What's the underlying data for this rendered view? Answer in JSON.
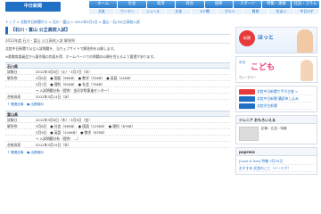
{
  "header": {
    "logo": "中日新聞",
    "nav_primary": [
      "ホーム",
      "社会",
      "経済",
      "政治",
      "国際",
      "スポーツ",
      "特集・連載",
      "社説・コラム"
    ],
    "nav_secondary": [
      "天気",
      "ウーマン",
      "ニュース",
      "文化",
      "ラテ欄",
      "グルメ",
      "教育",
      "住まい",
      "中日スポ"
    ],
    "breadcrumb": "トップ > 北陸中日新聞から > 石川・富山 > 2012年3月2日 > 富山・石川公立高校入試"
  },
  "article": {
    "title": "【石川・富山 公立高校入試】",
    "subtitle": "2012年度 石川・富山 公立高校入試 解答例",
    "note": "北陸中日新聞で公立入試問題を、当ウェブサイトで解答例を公開します。",
    "note2": "※県教育委員会から著作権の許諾を得、ホームページでの問題の公開を控えるよう要望があります。",
    "regions": [
      {
        "name": "石川県",
        "rows": [
          {
            "label": "試験日",
            "value": "2012年3月6日（火）・3月7日（水）"
          },
          {
            "label": "解答例",
            "value": "3月6日　● 国語（96KB）　● 数学（52KB）　● 英語（42KB）"
          },
          {
            "label": "",
            "value": "3月7日　● 理科（92KB）　● 社会（75KB）"
          },
          {
            "label": "",
            "value": "→ 入試問題分析（提供：金沢学院東進センター）"
          },
          {
            "label": "合格発表",
            "value": "2012年3月14日（水）"
          }
        ]
      },
      {
        "name": "富山県",
        "rows": [
          {
            "label": "試験日",
            "value": "2012年3月8日（木）・3月9日（金）"
          },
          {
            "label": "解答例",
            "value": "3月8日　● 社会（96KB）　● 国語（125KB）　● 理科（67KB）"
          },
          {
            "label": "",
            "value": "3月9日　● 英語（144KB）　● 数学（67KB）"
          },
          {
            "label": "",
            "value": "→ 入試問題分析（提供：…）"
          },
          {
            "label": "合格発表",
            "value": "2012年3月15日（木）"
          }
        ]
      }
    ],
    "back_link": "↑ 関連記事　● 出題傾向"
  },
  "sidebar": {
    "ad1": {
      "text": "ほっと",
      "badge": "新聞",
      "sub": "web"
    },
    "ad2": {
      "small": "中日",
      "big": "こども",
      "sub": "ウィークリー"
    },
    "links": [
      "北陸中日新聞で手引き書 >",
      "北陸中日新聞 購読申し込み",
      "北陸学生新聞"
    ],
    "section1": "ジュニア おもろいえる",
    "section1_caption": "記事・広告・特集",
    "section2": "popress",
    "section2_items": [
      "[Love & Sex] 特集 3月20日",
      "おすすめ 北陸のこと（イーテク）"
    ]
  },
  "colors": {
    "accent": "#1f6fc5",
    "region_bg": "#eef3f9"
  }
}
